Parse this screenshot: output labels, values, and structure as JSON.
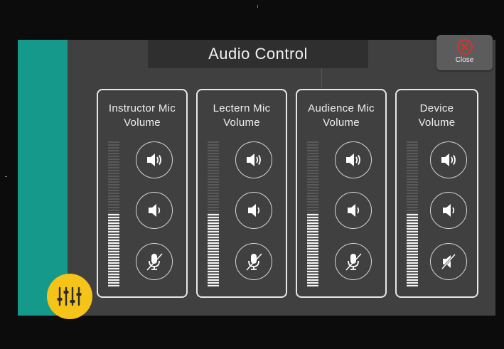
{
  "window": {
    "title": "Audio Control"
  },
  "close_button": {
    "label": "Close",
    "icon": "close-circle-icon"
  },
  "cards": [
    {
      "title_line1": "Instructor Mic",
      "title_line2": "Volume",
      "level": 0.5,
      "buttons": [
        "volume-up-icon",
        "volume-down-icon",
        "mic-mute-icon"
      ]
    },
    {
      "title_line1": "Lectern Mic",
      "title_line2": "Volume",
      "level": 0.5,
      "buttons": [
        "volume-up-icon",
        "volume-down-icon",
        "mic-mute-icon"
      ]
    },
    {
      "title_line1": "Audience Mic",
      "title_line2": "Volume",
      "level": 0.5,
      "buttons": [
        "volume-up-icon",
        "volume-down-icon",
        "mic-mute-icon"
      ]
    },
    {
      "title_line1": "Device",
      "title_line2": "Volume",
      "level": 0.5,
      "buttons": [
        "volume-up-icon",
        "volume-down-icon",
        "speaker-mute-icon"
      ]
    }
  ],
  "mixer_button": {
    "icon": "mixer-sliders-icon"
  },
  "colors": {
    "accent_teal": "#15998a",
    "badge_yellow": "#f6c418",
    "close_red": "#e0302a"
  }
}
